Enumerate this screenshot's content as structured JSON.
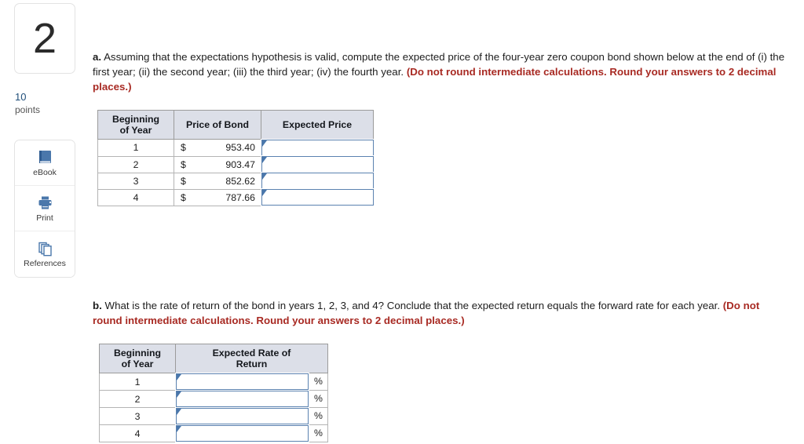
{
  "question": {
    "number": "2",
    "points_value": "10",
    "points_label": "points"
  },
  "tools": [
    {
      "label": "eBook",
      "icon": "book-icon"
    },
    {
      "label": "Print",
      "icon": "printer-icon"
    },
    {
      "label": "References",
      "icon": "pages-stack-icon"
    }
  ],
  "part_a": {
    "label": "a.",
    "text": "Assuming that the expectations hypothesis is valid, compute the expected price of the four-year zero coupon bond shown below at the end of (i) the first year; (ii) the second year; (iii) the third year; (iv) the fourth year.",
    "instruction": "(Do not round intermediate calculations. Round your answers to 2 decimal places.)",
    "table": {
      "headers": [
        "Beginning of Year",
        "Price of Bond",
        "Expected Price"
      ],
      "header_lines": [
        [
          "Beginning",
          "of Year"
        ],
        [
          "Price of Bond"
        ],
        [
          "Expected Price"
        ]
      ],
      "currency_symbol": "$",
      "rows": [
        {
          "year": "1",
          "price": "953.40",
          "expected_price": ""
        },
        {
          "year": "2",
          "price": "903.47",
          "expected_price": ""
        },
        {
          "year": "3",
          "price": "852.62",
          "expected_price": ""
        },
        {
          "year": "4",
          "price": "787.66",
          "expected_price": ""
        }
      ]
    }
  },
  "part_b": {
    "label": "b.",
    "text": "What is the rate of return of the bond in years 1, 2, 3, and 4? Conclude that the expected return equals the forward rate for each year.",
    "instruction": "(Do not round intermediate calculations. Round your answers to 2 decimal places.)",
    "table": {
      "headers": [
        "Beginning of Year",
        "Expected Rate of Return"
      ],
      "header_lines": [
        [
          "Beginning",
          "of Year"
        ],
        [
          "Expected Rate of",
          "Return"
        ]
      ],
      "percent_symbol": "%",
      "rows": [
        {
          "year": "1",
          "expected_rate": ""
        },
        {
          "year": "2",
          "expected_rate": ""
        },
        {
          "year": "3",
          "expected_rate": ""
        },
        {
          "year": "4",
          "expected_rate": ""
        }
      ]
    }
  },
  "colors": {
    "instruction_red": "#a82a23",
    "header_fill": "#dcdfe8",
    "input_border": "#5b82b0",
    "points_blue": "#1f4e79",
    "icon_blue": "#3f6fab"
  }
}
